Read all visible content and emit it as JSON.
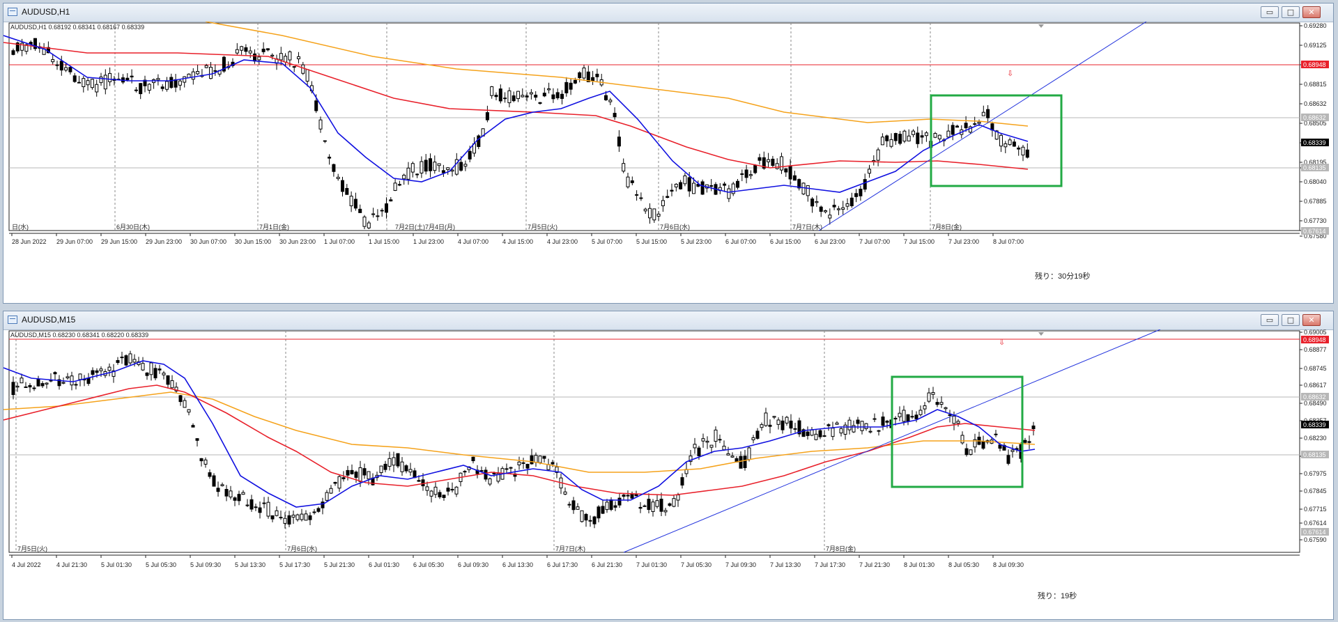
{
  "windows": [
    {
      "title": "AUDUSD,H1",
      "header": "AUDUSD,H1  0.68192 0.68341 0.68167 0.68339",
      "remaining": "残り：30分19秒",
      "y_ticks": [
        "0.69280",
        "0.69125",
        "0.68948",
        "0.68815",
        "0.68632",
        "0.68505",
        "0.68339",
        "0.68195",
        "0.68135",
        "0.68040",
        "0.67885",
        "0.67730",
        "0.67614",
        "0.67580"
      ],
      "price_badges": [
        {
          "text": "0.68948",
          "color": "#e8202a"
        },
        {
          "text": "0.68632",
          "color": "#b7b7b7"
        },
        {
          "text": "0.68339",
          "color": "#000000"
        },
        {
          "text": "0.68135",
          "color": "#b7b7b7"
        },
        {
          "text": "0.67614",
          "color": "#b7b7b7"
        }
      ],
      "day_labels": [
        "日(水)",
        "6月30日(木)",
        "7月1日(金)",
        "7月2日(土)7月4日(月)",
        "7月5日(火)",
        "7月6日(水)",
        "7月7日(木)",
        "7月8日(金)"
      ],
      "x_ticks": [
        "28 Jun 2022",
        "29 Jun 07:00",
        "29 Jun 15:00",
        "29 Jun 23:00",
        "30 Jun 07:00",
        "30 Jun 15:00",
        "30 Jun 23:00",
        "1 Jul 07:00",
        "1 Jul 15:00",
        "1 Jul 23:00",
        "4 Jul 07:00",
        "4 Jul 15:00",
        "4 Jul 23:00",
        "5 Jul 07:00",
        "5 Jul 15:00",
        "5 Jul 23:00",
        "6 Jul 07:00",
        "6 Jul 15:00",
        "6 Jul 23:00",
        "7 Jul 07:00",
        "7 Jul 15:00",
        "7 Jul 23:00",
        "8 Jul 07:00"
      ]
    },
    {
      "title": "AUDUSD,M15",
      "header": "AUDUSD,M15  0.68230 0.68341 0.68220 0.68339",
      "remaining": "残り：19秒",
      "y_ticks": [
        "0.69005",
        "0.68877",
        "0.68745",
        "0.68617",
        "0.68490",
        "0.68357",
        "0.68230",
        "0.68100",
        "0.67975",
        "0.67845",
        "0.67715",
        "0.67614",
        "0.67590"
      ],
      "price_badges": [
        {
          "text": "0.68948",
          "color": "#e8202a"
        },
        {
          "text": "0.68632",
          "color": "#b7b7b7"
        },
        {
          "text": "0.68339",
          "color": "#000000"
        },
        {
          "text": "0.68135",
          "color": "#b7b7b7"
        },
        {
          "text": "0.67614",
          "color": "#b7b7b7"
        }
      ],
      "day_labels": [
        "7月5日(火)",
        "7月6日(水)",
        "7月7日(木)",
        "7月8日(金)"
      ],
      "x_ticks": [
        "4 Jul 2022",
        "4 Jul 21:30",
        "5 Jul 01:30",
        "5 Jul 05:30",
        "5 Jul 09:30",
        "5 Jul 13:30",
        "5 Jul 17:30",
        "5 Jul 21:30",
        "6 Jul 01:30",
        "6 Jul 05:30",
        "6 Jul 09:30",
        "6 Jul 13:30",
        "6 Jul 17:30",
        "6 Jul 21:30",
        "7 Jul 01:30",
        "7 Jul 05:30",
        "7 Jul 09:30",
        "7 Jul 13:30",
        "7 Jul 17:30",
        "7 Jul 21:30",
        "8 Jul 01:30",
        "8 Jul 05:30",
        "8 Jul 09:30"
      ]
    }
  ],
  "controls": {
    "minimize": "▭",
    "maximize": "□",
    "close": "✕"
  },
  "colors": {
    "ma_fast": "#1010e0",
    "ma_mid": "#e8202a",
    "ma_slow": "#f5a21a",
    "highlight": "#22aa44",
    "hline": "#e8202a"
  }
}
